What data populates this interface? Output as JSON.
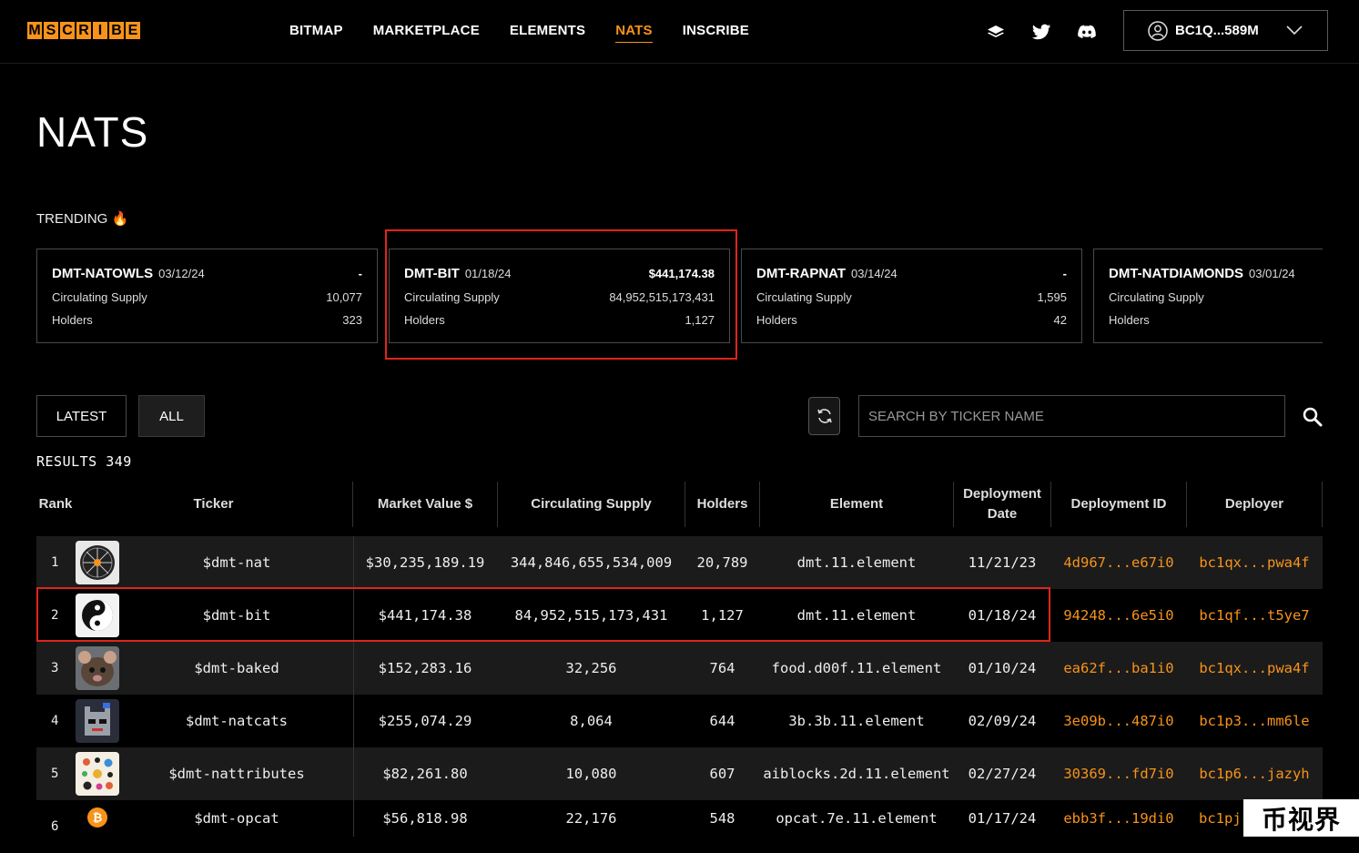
{
  "header": {
    "logo_letters": [
      "M",
      "S",
      "C",
      "R",
      "I",
      "B",
      "E"
    ],
    "nav": [
      "BITMAP",
      "MARKETPLACE",
      "ELEMENTS",
      "NATS",
      "INSCRIBE"
    ],
    "active_nav": "NATS",
    "icons": [
      "stack-icon",
      "twitter-icon",
      "discord-icon"
    ],
    "wallet_address": "BC1Q...589M"
  },
  "page_title": "NATS",
  "trending": {
    "label": "TRENDING 🔥",
    "cards": [
      {
        "name": "DMT-NATOWLS",
        "date": "03/12/24",
        "value": "-",
        "supply_label": "Circulating Supply",
        "supply": "10,077",
        "holders_label": "Holders",
        "holders": "323"
      },
      {
        "name": "DMT-BIT",
        "date": "01/18/24",
        "value": "$441,174.38",
        "supply_label": "Circulating Supply",
        "supply": "84,952,515,173,431",
        "holders_label": "Holders",
        "holders": "1,127"
      },
      {
        "name": "DMT-RAPNAT",
        "date": "03/14/24",
        "value": "-",
        "supply_label": "Circulating Supply",
        "supply": "1,595",
        "holders_label": "Holders",
        "holders": "42"
      },
      {
        "name": "DMT-NATDIAMONDS",
        "date": "03/01/24",
        "value": "",
        "supply_label": "Circulating Supply",
        "supply": "",
        "holders_label": "Holders",
        "holders": ""
      }
    ]
  },
  "filters": {
    "latest": "LATEST",
    "all": "ALL",
    "active": "ALL"
  },
  "search": {
    "placeholder": "SEARCH BY TICKER NAME"
  },
  "results": {
    "label": "RESULTS",
    "count": "349"
  },
  "table": {
    "headers": [
      "Rank",
      "Ticker",
      "Market Value $",
      "Circulating Supply",
      "Holders",
      "Element",
      "Deployment Date",
      "Deployment ID",
      "Deployer"
    ],
    "rows": [
      {
        "rank": "1",
        "ticker": "$dmt-nat",
        "market_value": "$30,235,189.19",
        "supply": "344,846,655,534,009",
        "holders": "20,789",
        "element": "dmt.11.element",
        "date": "11/21/23",
        "deploy_id": "4d967...e67i0",
        "deployer": "bc1qx...pwa4f",
        "avatar": "nat-avatar"
      },
      {
        "rank": "2",
        "ticker": "$dmt-bit",
        "market_value": "$441,174.38",
        "supply": "84,952,515,173,431",
        "holders": "1,127",
        "element": "dmt.11.element",
        "date": "01/18/24",
        "deploy_id": "94248...6e5i0",
        "deployer": "bc1qf...t5ye7",
        "avatar": "yinyang-avatar"
      },
      {
        "rank": "3",
        "ticker": "$dmt-baked",
        "market_value": "$152,283.16",
        "supply": "32,256",
        "holders": "764",
        "element": "food.d00f.11.element",
        "date": "01/10/24",
        "deploy_id": "ea62f...ba1i0",
        "deployer": "bc1qx...pwa4f",
        "avatar": "rodent-avatar"
      },
      {
        "rank": "4",
        "ticker": "$dmt-natcats",
        "market_value": "$255,074.29",
        "supply": "8,064",
        "holders": "644",
        "element": "3b.3b.11.element",
        "date": "02/09/24",
        "deploy_id": "3e09b...487i0",
        "deployer": "bc1p3...mm6le",
        "avatar": "pixel-cat-avatar"
      },
      {
        "rank": "5",
        "ticker": "$dmt-nattributes",
        "market_value": "$82,261.80",
        "supply": "10,080",
        "holders": "607",
        "element": "aiblocks.2d.11.element",
        "date": "02/27/24",
        "deploy_id": "30369...fd7i0",
        "deployer": "bc1p6...jazyh",
        "avatar": "dots-avatar"
      },
      {
        "rank": "6",
        "ticker": "$dmt-opcat",
        "market_value": "$56,818.98",
        "supply": "22,176",
        "holders": "548",
        "element": "opcat.7e.11.element",
        "date": "01/17/24",
        "deploy_id": "ebb3f...19di0",
        "deployer": "bc1pj",
        "avatar": "bitcoin-avatar"
      }
    ]
  },
  "watermark": "币视界",
  "colors": {
    "accent": "#f7931a",
    "highlight": "#e0241b",
    "background": "#000000",
    "row_alt": "#1b1b1b"
  }
}
